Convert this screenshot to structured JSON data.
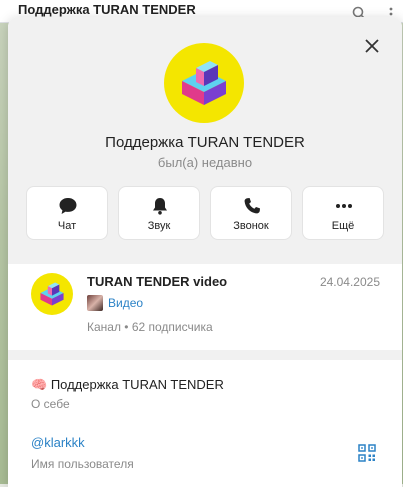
{
  "window": {
    "title": "Поддержка TURAN TENDER"
  },
  "profile": {
    "name": "Поддержка TURAN TENDER",
    "status": "был(а) недавно"
  },
  "actions": [
    {
      "label": "Чат",
      "icon": "chat-icon"
    },
    {
      "label": "Звук",
      "icon": "bell-icon"
    },
    {
      "label": "Звонок",
      "icon": "phone-icon"
    },
    {
      "label": "Ещё",
      "icon": "more-icon"
    }
  ],
  "channel": {
    "title": "TURAN TENDER video",
    "date": "24.04.2025",
    "last_message": "Видео",
    "meta": "Канал • 62 подписчика"
  },
  "info": {
    "about_emoji": "🧠",
    "about_text": "Поддержка TURAN TENDER",
    "about_label": "О себе",
    "username": "@klarkkk",
    "username_label": "Имя пользователя"
  },
  "colors": {
    "logo_bg": "#f4e600",
    "link": "#2b82c6",
    "muted": "#8a8a8a"
  }
}
